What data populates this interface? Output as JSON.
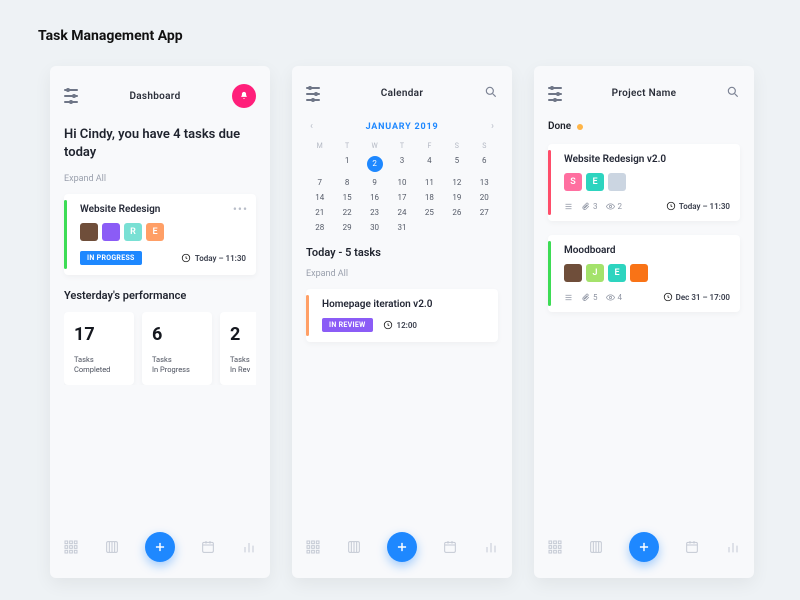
{
  "app_title": "Task Management App",
  "dashboard": {
    "title": "Dashboard",
    "greeting": "Hi Cindy, you have 4 tasks due today",
    "expand": "Expand All",
    "card": {
      "title": "Website Redesign",
      "stripe": "#3ddc55",
      "avatars": [
        {
          "bg": "#6f4e3a",
          "t": ""
        },
        {
          "bg": "#8b5cf6",
          "t": ""
        },
        {
          "bg": "#79e0d4",
          "t": "R"
        },
        {
          "bg": "#ff9f66",
          "t": "E"
        }
      ],
      "badge": {
        "label": "IN PROGRESS",
        "color": "#1e88ff"
      },
      "time": "Today – 11:30"
    },
    "perf_title": "Yesterday's performance",
    "stats": [
      {
        "n": "17",
        "l": "Tasks\nCompleted"
      },
      {
        "n": "6",
        "l": "Tasks\nIn Progress"
      },
      {
        "n": "2",
        "l": "Tasks\nIn Rev"
      }
    ]
  },
  "calendar": {
    "title": "Calendar",
    "month": "JANUARY 2019",
    "dow": [
      "M",
      "T",
      "W",
      "T",
      "F",
      "S",
      "S"
    ],
    "days": [
      "",
      "1",
      "2",
      "3",
      "4",
      "5",
      "6",
      "7",
      "8",
      "9",
      "10",
      "11",
      "12",
      "13",
      "14",
      "15",
      "16",
      "17",
      "18",
      "19",
      "20",
      "21",
      "22",
      "23",
      "24",
      "25",
      "26",
      "27",
      "28",
      "29",
      "30",
      "31",
      "",
      "",
      ""
    ],
    "selected": "2",
    "today_label": "Today - 5 tasks",
    "expand": "Expand All",
    "card": {
      "title": "Homepage iteration v2.0",
      "stripe": "#ff9f66",
      "badge": {
        "label": "IN REVIEW",
        "color": "#8b5cf6"
      },
      "time": "12:00"
    }
  },
  "project": {
    "title": "Project Name",
    "status": "Done",
    "status_color": "#ffb547",
    "cards": [
      {
        "title": "Website Redesign v2.0",
        "stripe": "#ff4d6a",
        "avatars": [
          {
            "bg": "#ff6fa0",
            "t": "S"
          },
          {
            "bg": "#2dd4bf",
            "t": "E"
          },
          {
            "bg": "#cbd5e1",
            "t": ""
          }
        ],
        "list": "",
        "attach": "3",
        "views": "2",
        "time": "Today – 11:30"
      },
      {
        "title": "Moodboard",
        "stripe": "#3ddc55",
        "avatars": [
          {
            "bg": "#6f4e3a",
            "t": ""
          },
          {
            "bg": "#a4e26b",
            "t": "J"
          },
          {
            "bg": "#2dd4bf",
            "t": "E"
          },
          {
            "bg": "#f97316",
            "t": ""
          }
        ],
        "attach": "5",
        "views": "4",
        "time": "Dec 31 – 17:00"
      }
    ]
  }
}
